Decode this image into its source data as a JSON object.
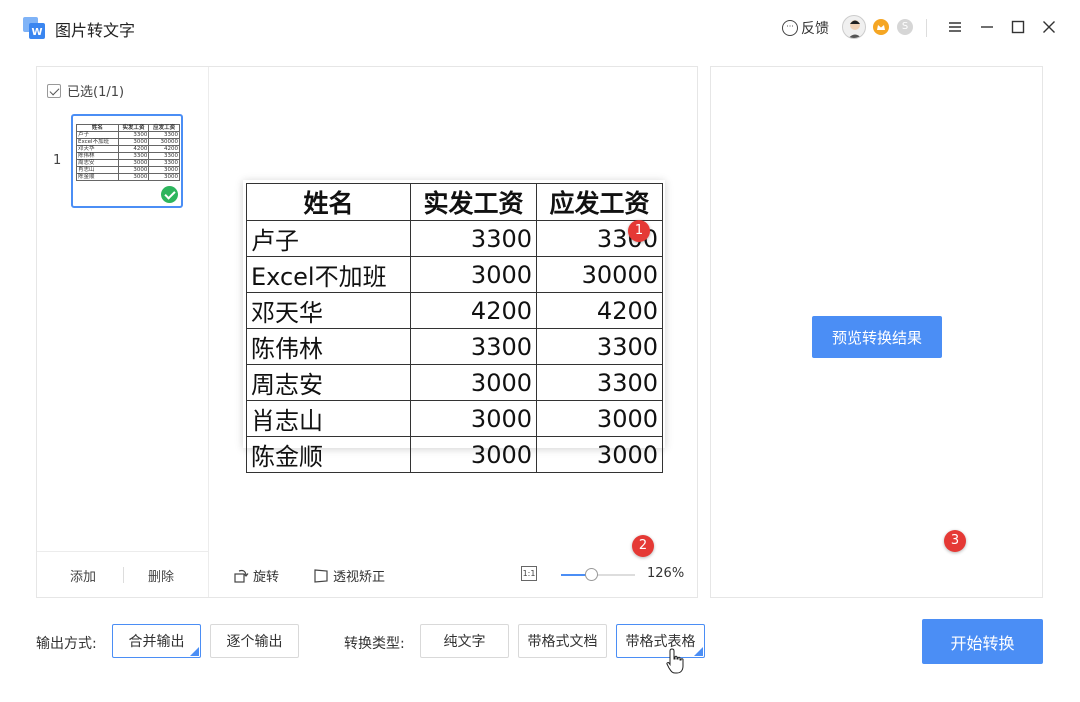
{
  "app": {
    "title": "图片转文字",
    "feedback": "反馈"
  },
  "icons": {
    "logo": "image-to-text-logo-icon",
    "feedback": "chat-bubble-icon",
    "menu": "hamburger-menu-icon",
    "minimize": "minimize-icon",
    "maximize": "maximize-icon",
    "close": "close-icon",
    "rotate": "rotate-icon",
    "perspective": "perspective-correct-icon",
    "fit": "fit-actual-size-icon",
    "check": "check-icon"
  },
  "colors": {
    "accent": "#4b8ef5",
    "marker": "#e53935",
    "success": "#2db55d"
  },
  "sidebar": {
    "select_all": "已选(1/1)",
    "thumb_index": "1",
    "add": "添加",
    "delete": "删除"
  },
  "table": {
    "headers": [
      "姓名",
      "实发工资",
      "应发工资"
    ],
    "rows": [
      [
        "卢子",
        "3300",
        "3300"
      ],
      [
        "Excel不加班",
        "3000",
        "30000"
      ],
      [
        "邓天华",
        "4200",
        "4200"
      ],
      [
        "陈伟林",
        "3300",
        "3300"
      ],
      [
        "周志安",
        "3000",
        "3300"
      ],
      [
        "肖志山",
        "3000",
        "3000"
      ],
      [
        "陈金顺",
        "3000",
        "3000"
      ]
    ]
  },
  "toolbar": {
    "rotate": "旋转",
    "perspective": "透视矫正",
    "fit_label": "1:1",
    "zoom": "126%",
    "zoom_fraction": 0.4
  },
  "right": {
    "preview_result": "预览转换结果"
  },
  "bottom": {
    "output_label": "输出方式:",
    "merge": "合并输出",
    "single": "逐个输出",
    "type_label": "转换类型:",
    "plain": "纯文字",
    "fmt_doc": "带格式文档",
    "fmt_table": "带格式表格",
    "start": "开始转换"
  },
  "markers": [
    "1",
    "2",
    "3"
  ]
}
